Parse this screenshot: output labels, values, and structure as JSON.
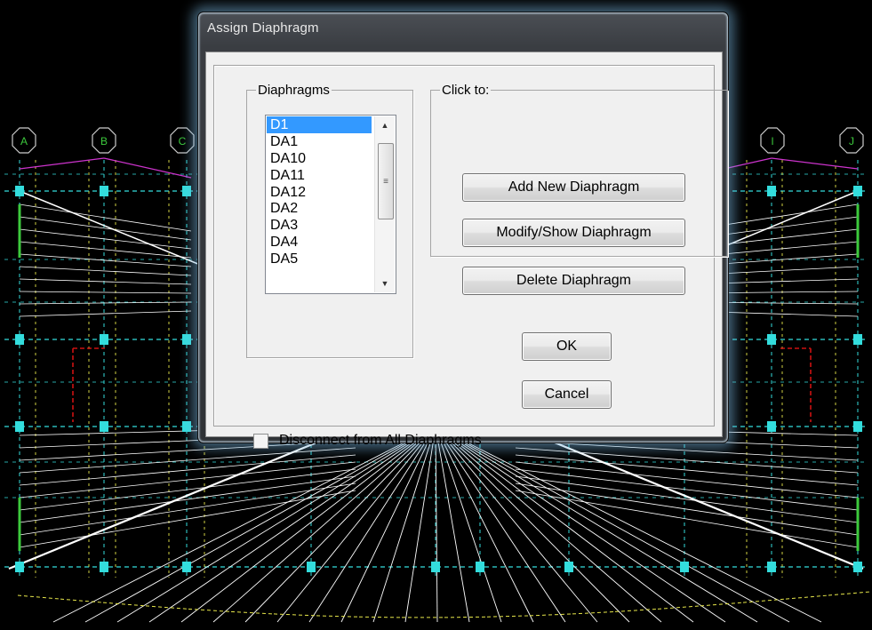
{
  "background": {
    "grid_labels": [
      "A",
      "B",
      "C",
      "I",
      "J"
    ]
  },
  "dialog": {
    "title": "Assign Diaphragm",
    "diaphragms_group": {
      "legend": "Diaphragms",
      "items": [
        "D1",
        "DA1",
        "DA10",
        "DA11",
        "DA12",
        "DA2",
        "DA3",
        "DA4",
        "DA5"
      ],
      "selected": "D1"
    },
    "click_to_group": {
      "legend": "Click to:",
      "add_label": "Add New Diaphragm",
      "modify_label": "Modify/Show Diaphragm",
      "delete_label": "Delete Diaphragm"
    },
    "ok_label": "OK",
    "cancel_label": "Cancel",
    "disconnect_label": "Disconnect from All Diaphragms",
    "disconnect_checked": false
  },
  "colors": {
    "selection": "#3399ff",
    "grid_bubble": "#3cc93c",
    "beam": "#ffffff",
    "dashed": "#33dddd"
  }
}
